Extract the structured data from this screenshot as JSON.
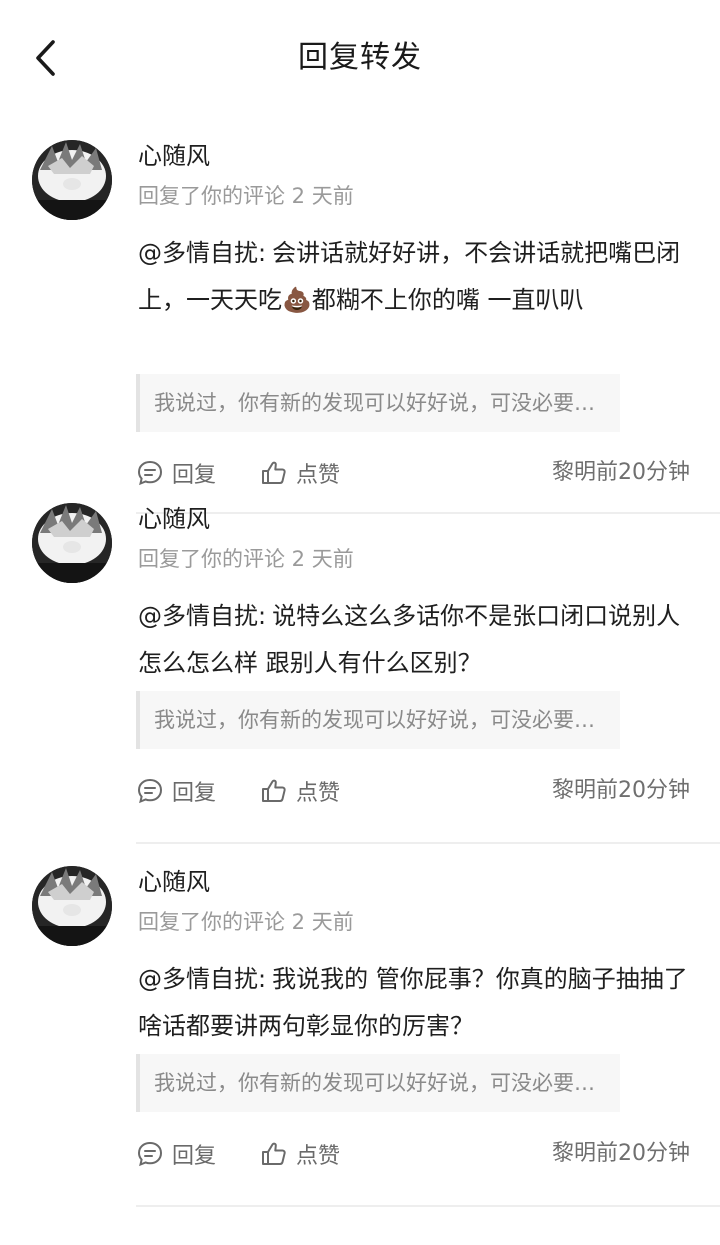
{
  "header": {
    "title": "回复转发"
  },
  "comments": [
    {
      "name": "心随风",
      "meta": "回复了你的评论 2 天前",
      "mention": "@多情自扰:",
      "text": "会讲话就好好讲，不会讲话就把嘴巴闭上，一天天吃💩都糊不上你的嘴  一直叭叭",
      "quote": "我说过，你有新的发现可以好好说，可没必要…",
      "reply_label": "回复",
      "like_label": "点赞",
      "time": "黎明前20分钟"
    },
    {
      "name": "心随风",
      "meta": "回复了你的评论 2 天前",
      "mention": "@多情自扰:",
      "text": "说特么这么多话你不是张口闭口说别人怎么怎么样  跟别人有什么区别？",
      "quote": "我说过，你有新的发现可以好好说，可没必要…",
      "reply_label": "回复",
      "like_label": "点赞",
      "time": "黎明前20分钟"
    },
    {
      "name": "心随风",
      "meta": "回复了你的评论 2 天前",
      "mention": "@多情自扰:",
      "text": "我说我的 管你屁事？你真的脑子抽抽了 啥话都要讲两句彰显你的厉害？",
      "quote": "我说过，你有新的发现可以好好说，可没必要…",
      "reply_label": "回复",
      "like_label": "点赞",
      "time": "黎明前20分钟"
    }
  ],
  "icons": {
    "back": "chevron-left-icon",
    "reply": "comment-bubble-icon",
    "like": "thumbs-up-icon"
  }
}
